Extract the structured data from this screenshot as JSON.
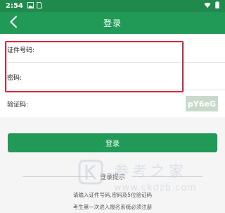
{
  "status_bar": {
    "time": "2:54"
  },
  "header": {
    "title": "登录"
  },
  "form": {
    "id_label": "证件号码:",
    "id_value": "",
    "password_label": "密码:",
    "password_value": "",
    "captcha_label": "验证码:",
    "captcha_value": "",
    "captcha_text": "pY6eG"
  },
  "login_button": {
    "label": "登录"
  },
  "tips": {
    "title": "登录提示",
    "lines": [
      "请输入证件号码,密码及5位验证码",
      "考生第一次进入报名系统必须注册"
    ]
  },
  "watermark": {
    "cn": "参考之家",
    "url": "www.ckdzb.com"
  },
  "colors": {
    "status_bar_bg": "#1f8a4c",
    "primary_green": "#209a56",
    "highlight_red": "#d7263d"
  },
  "icons": {
    "back": "chevron-left-icon",
    "status_left": [
      "image-icon",
      "sim-card-icon"
    ],
    "status_right": [
      "wifi-icon",
      "battery-icon"
    ]
  }
}
